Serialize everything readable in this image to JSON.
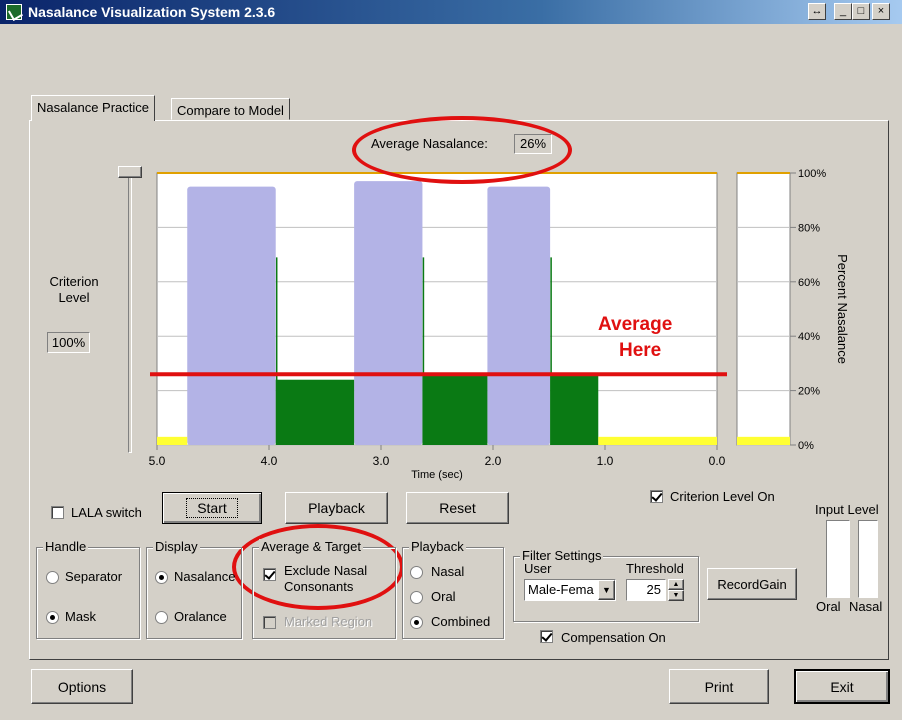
{
  "window": {
    "title": "Nasalance Visualization System 2.3.6",
    "resize_glyph": "↔",
    "min_glyph": "_",
    "max_glyph": "□",
    "close_glyph": "×"
  },
  "tabs": [
    "Nasalance Practice",
    "Compare to Model"
  ],
  "average": {
    "label": "Average Nasalance:",
    "value": "26%"
  },
  "criterion": {
    "label_line1": "Criterion",
    "label_line2": "Level",
    "value": "100%"
  },
  "annotation": {
    "line1": "Average",
    "line2": "Here",
    "color": "#e01010"
  },
  "chart_data": {
    "type": "area",
    "xlabel": "Time (sec)",
    "x_ticks": [
      "5.0",
      "4.0",
      "3.0",
      "2.0",
      "1.0",
      "0.0"
    ],
    "xlim": [
      5.0,
      0.0
    ],
    "y_ticks": [
      "100%",
      "80%",
      "60%",
      "40%",
      "20%",
      "0%"
    ],
    "ylabel": "Percent Nasalance",
    "ylim": [
      0,
      100
    ],
    "average_line": 26,
    "criterion_line": 100,
    "series": [
      {
        "color": "#b3b3e6",
        "segments": [
          {
            "x": [
              4.73,
              3.94
            ],
            "y": 95
          },
          {
            "x": [
              3.24,
              2.63
            ],
            "y": 97
          },
          {
            "x": [
              2.05,
              1.49
            ],
            "y": 95
          }
        ]
      },
      {
        "color": "#0a7a14",
        "segments": [
          {
            "x": [
              3.94,
              3.24
            ],
            "y": 24
          },
          {
            "x": [
              2.63,
              2.05
            ],
            "y": 26
          },
          {
            "x": [
              1.49,
              1.06
            ],
            "y": 26
          }
        ]
      },
      {
        "color": "#ffff33",
        "segments": [
          {
            "x": [
              5.0,
              4.73
            ],
            "y": 3
          },
          {
            "x": [
              1.06,
              0.0
            ],
            "y": 3
          }
        ]
      }
    ],
    "side_bar": {
      "value": 3,
      "color": "#ffff33"
    }
  },
  "controls": {
    "lala_switch": "LALA switch",
    "start": "Start",
    "playback": "Playback",
    "reset": "Reset",
    "criterion_on": "Criterion Level On",
    "input_level": "Input Level",
    "oral": "Oral",
    "nasal": "Nasal"
  },
  "handle": {
    "title": "Handle",
    "options": [
      "Separator",
      "Mask"
    ],
    "selected": "Mask"
  },
  "display": {
    "title": "Display",
    "options": [
      "Nasalance",
      "Oralance"
    ],
    "selected": "Nasalance"
  },
  "avg_target": {
    "title": "Average & Target",
    "exclude_line1": "Exclude Nasal",
    "exclude_line2": "Consonants",
    "marked_region": "Marked Region"
  },
  "playback_group": {
    "title": "Playback",
    "options": [
      "Nasal",
      "Oral",
      "Combined"
    ],
    "selected": "Combined"
  },
  "filter": {
    "title": "Filter Settings",
    "user_label": "User",
    "user_value": "Male-Fema",
    "threshold_label": "Threshold",
    "threshold_value": "25"
  },
  "record_gain": "RecordGain",
  "compensation": "Compensation On",
  "bottom": {
    "options": "Options",
    "print": "Print",
    "exit": "Exit"
  }
}
